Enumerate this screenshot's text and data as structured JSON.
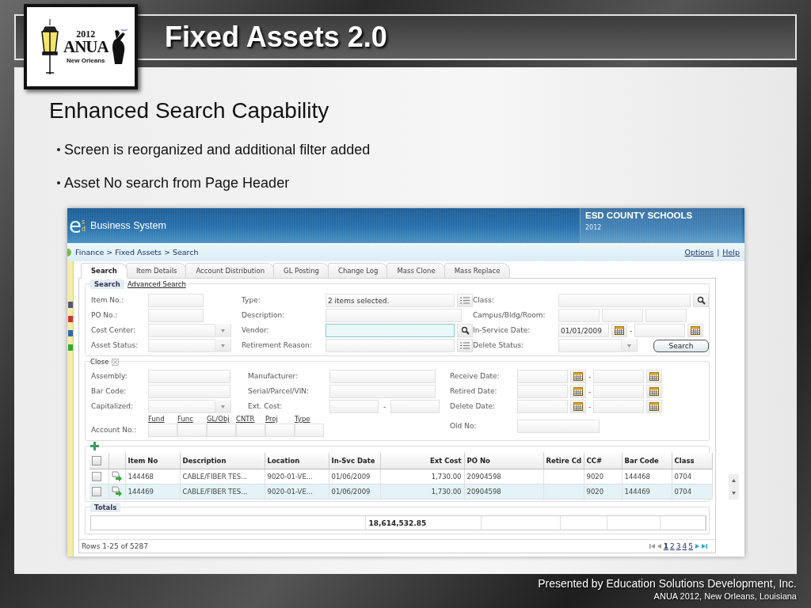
{
  "slide": {
    "title": "Fixed Assets 2.0",
    "logo": {
      "year": "2012",
      "name": "ANUA",
      "city": "New Orleans"
    },
    "heading": "Enhanced Search Capability",
    "bullets": [
      "Screen is reorganized and additional filter added",
      "Asset No search from Page Header"
    ],
    "footer": [
      "Presented by Education Solutions Development, Inc.",
      "ANUA 2012, New Orleans, Louisiana"
    ]
  },
  "app": {
    "brand": {
      "mark": "e",
      "sup": "s",
      "sub": "d",
      "name": "Business System"
    },
    "org": {
      "name": "ESD COUNTY SCHOOLS",
      "year": "2012"
    },
    "breadcrumb": "Finance > Fixed Assets > Search",
    "links": [
      "Options",
      "Help"
    ],
    "separator": "|",
    "tabs": [
      {
        "label": "Search",
        "selected": true
      },
      {
        "label": "Item Details",
        "selected": false
      },
      {
        "label": "Account Distribution",
        "selected": false
      },
      {
        "label": "GL Posting",
        "selected": false
      },
      {
        "label": "Change Log",
        "selected": false
      },
      {
        "label": "Mass Clone",
        "selected": false
      },
      {
        "label": "Mass Replace",
        "selected": false
      }
    ],
    "search_panel": {
      "legend": "Search",
      "link": "Advanced Search",
      "button": "Search",
      "rows": [
        [
          {
            "label": "Item No.:",
            "kind": "text",
            "focused": false
          },
          {
            "label": "Type:",
            "kind": "list",
            "value": "2 items selected.",
            "focused": false
          },
          {
            "label": "Class:",
            "kind": "lookup",
            "focused": false
          }
        ],
        [
          {
            "label": "PO No.:",
            "kind": "text",
            "focused": false
          },
          {
            "label": "Description:",
            "kind": "text",
            "focused": false
          },
          {
            "label": "Campus/Bldg/Room:",
            "kind": "triple",
            "focused": false
          }
        ],
        [
          {
            "label": "Cost Center:",
            "kind": "dropdown",
            "focused": false
          },
          {
            "label": "Vendor:",
            "kind": "lookup",
            "focused": true
          },
          {
            "label": "In-Service Date:",
            "kind": "date_range",
            "from": "01/01/2009",
            "dash": "-",
            "focused": false
          }
        ],
        [
          {
            "label": "Asset Status:",
            "kind": "dropdown",
            "focused": false
          },
          {
            "label": "Retirement Reason:",
            "kind": "list",
            "focused": false
          },
          {
            "label": "Delete Status:",
            "kind": "dropdown",
            "focused": false
          }
        ]
      ]
    },
    "more_panel": {
      "legend": "Close",
      "rows": [
        [
          {
            "label": "Assembly:",
            "kind": "text",
            "focused": false
          },
          {
            "label": "Manufacturer:",
            "kind": "text",
            "focused": false
          },
          {
            "label": "Receive Date:",
            "kind": "date_range",
            "dash": "-",
            "focused": false
          }
        ],
        [
          {
            "label": "Bar Code:",
            "kind": "text",
            "focused": false
          },
          {
            "label": "Serial/Parcel/VIN:",
            "kind": "text",
            "focused": false
          },
          {
            "label": "Retired Date:",
            "kind": "date_range",
            "dash": "-",
            "focused": false
          }
        ],
        [
          {
            "label": "Capitalized:",
            "kind": "dropdown",
            "focused": false
          },
          {
            "label": "Ext. Cost:",
            "kind": "range",
            "dash": "-",
            "focused": false
          },
          {
            "label": "Delete Date:",
            "kind": "date_range",
            "dash": "-",
            "focused": false
          }
        ],
        [
          {
            "label": "Account No.:",
            "kind": "account",
            "segments": [
              "Fund",
              "Func",
              "GL/Obj",
              "CNTR",
              "Proj",
              "Type"
            ],
            "focused": false
          },
          "",
          {
            "label": "Old No:",
            "kind": "text",
            "focused": false
          }
        ]
      ]
    },
    "results": {
      "all_checked": false,
      "columns": [
        "Item No",
        "Description",
        "Location",
        "In-Svc Date",
        "Ext Cost",
        "PO No",
        "Retire Cd",
        "CC#",
        "Bar Code",
        "Class"
      ],
      "rows": [
        {
          "checked": false,
          "selected": false,
          "cells": [
            "144468",
            "CABLE/FIBER TES...",
            "9020-01-VE...",
            "01/06/2009",
            "1,730.00",
            "20904598",
            null,
            "9020",
            "144468",
            "0704"
          ]
        },
        {
          "checked": false,
          "selected": true,
          "cells": [
            "144469",
            "CABLE/FIBER TES...",
            "9020-01-VE...",
            "01/06/2009",
            "1,730.00",
            "20904598",
            null,
            "9020",
            "144469",
            "0704"
          ]
        }
      ],
      "totals_legend": "Totals",
      "total": "18,614,532.85"
    },
    "status": "Rows 1-25 of 5287",
    "pages": [
      {
        "label": "1",
        "selected": true
      },
      {
        "label": "2",
        "selected": false
      },
      {
        "label": "3",
        "selected": false
      },
      {
        "label": "4",
        "selected": false
      },
      {
        "label": "5",
        "selected": false
      }
    ]
  }
}
